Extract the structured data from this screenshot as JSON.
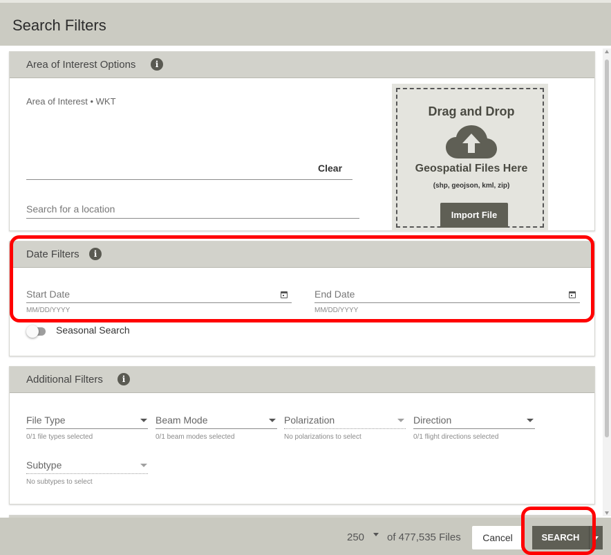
{
  "header": {
    "title": "Search Filters"
  },
  "area": {
    "heading": "Area of Interest Options",
    "wkt_label": "Area of Interest • WKT",
    "clear_label": "Clear",
    "location_placeholder": "Search for a location",
    "dropzone": {
      "title": "Drag and Drop",
      "subtitle": "Geospatial Files Here",
      "types": "(shp, geojson, kml, zip)",
      "import_label": "Import File"
    }
  },
  "date": {
    "heading": "Date Filters",
    "start_label": "Start Date",
    "start_hint": "MM/DD/YYYY",
    "end_label": "End Date",
    "end_hint": "MM/DD/YYYY",
    "seasonal_label": "Seasonal Search",
    "seasonal_on": false
  },
  "additional": {
    "heading": "Additional Filters",
    "filters": [
      {
        "label": "File Type",
        "hint": "0/1 file types selected",
        "enabled": true
      },
      {
        "label": "Beam Mode",
        "hint": "0/1 beam modes selected",
        "enabled": true
      },
      {
        "label": "Polarization",
        "hint": "No polarizations to select",
        "enabled": false
      },
      {
        "label": "Direction",
        "hint": "0/1 flight directions selected",
        "enabled": true
      }
    ],
    "subtype": {
      "label": "Subtype",
      "hint": "No subtypes to select",
      "enabled": false
    }
  },
  "footer": {
    "max_results": "250",
    "total_label": "of 477,535 Files",
    "cancel_label": "Cancel",
    "search_label": "SEARCH"
  },
  "colors": {
    "header_bg": "#cbcbc2",
    "primary_button": "#5f5f55",
    "highlight": "#ff0000"
  }
}
